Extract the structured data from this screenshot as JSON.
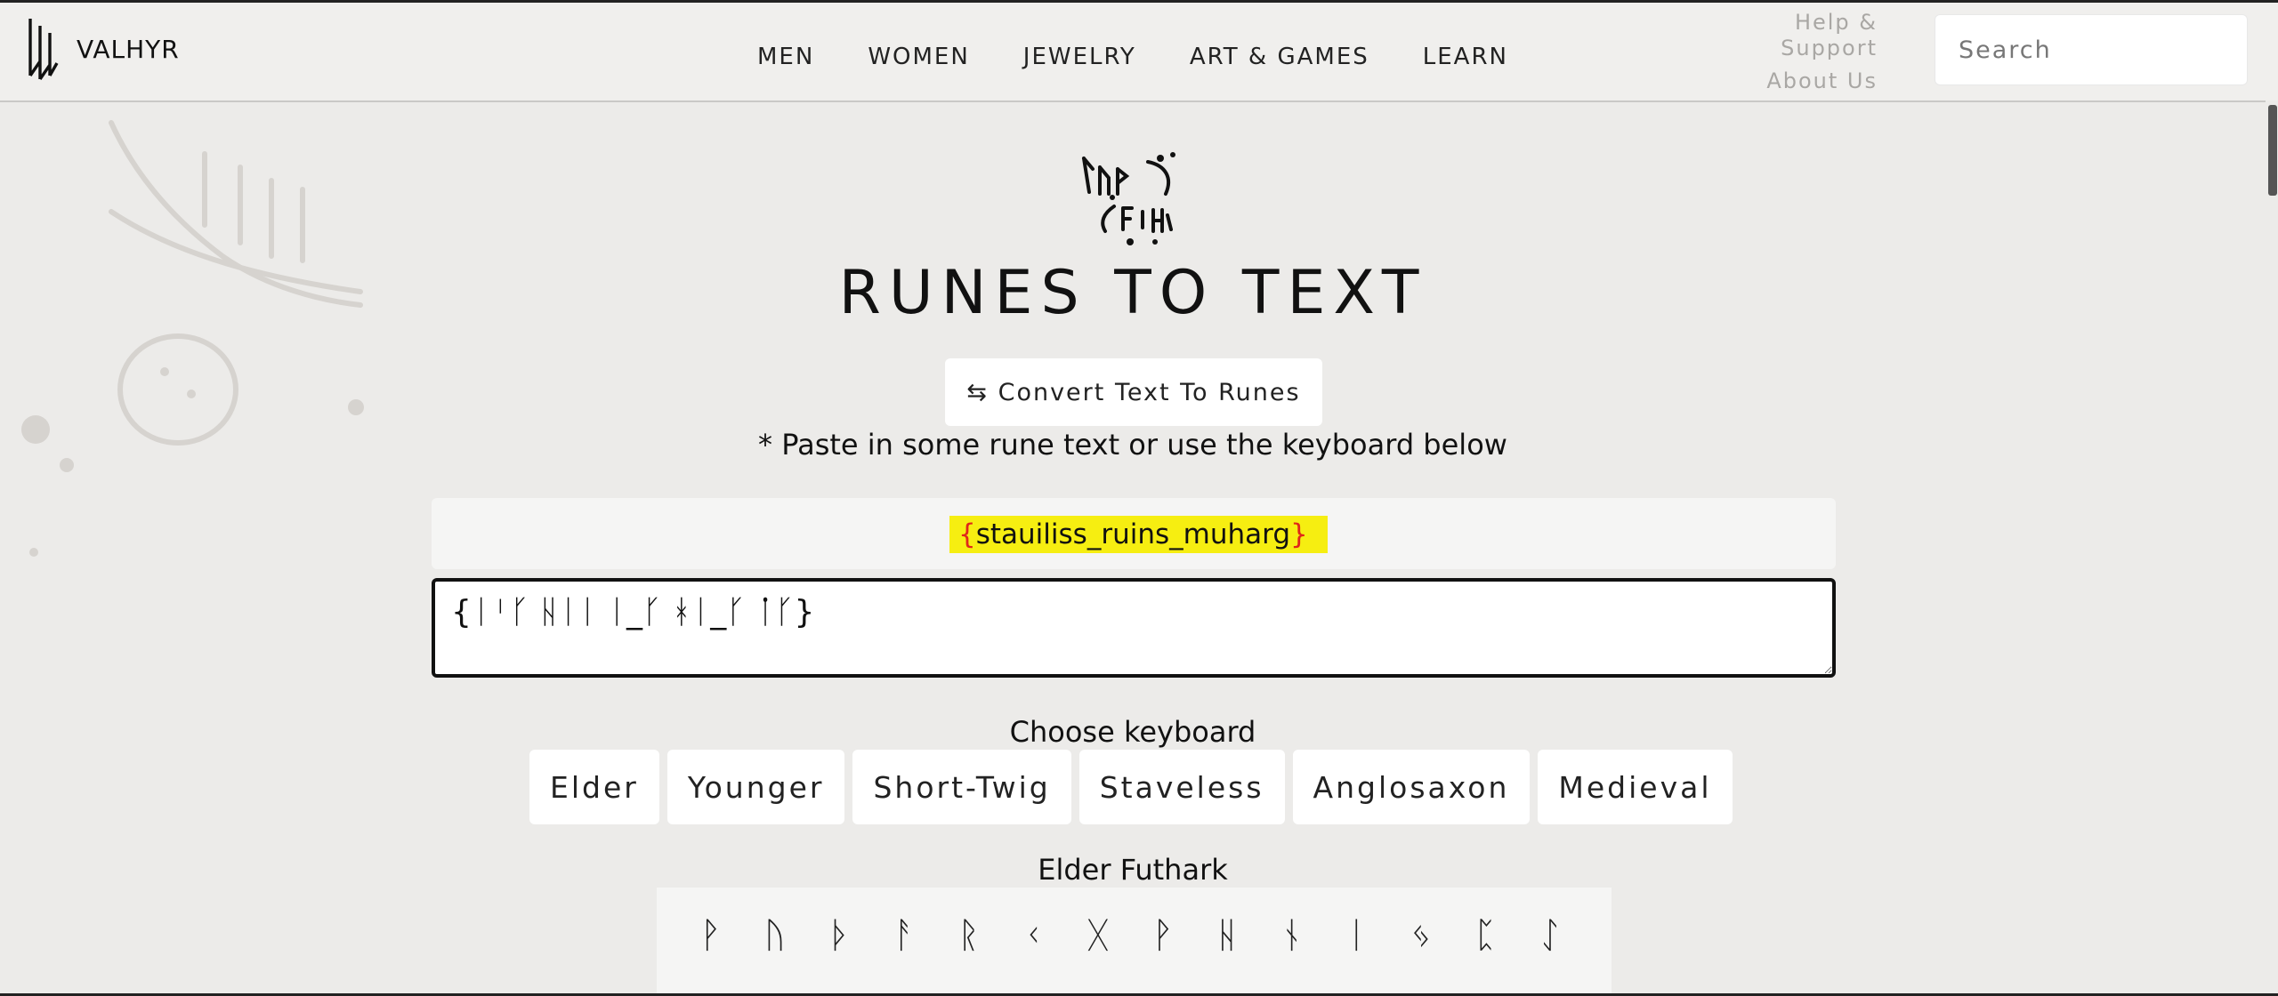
{
  "brand": {
    "name": "VALHYR",
    "logo_icon": "valhyr-rune-logo-icon"
  },
  "nav": {
    "items": [
      {
        "label": "MEN"
      },
      {
        "label": "WOMEN"
      },
      {
        "label": "JEWELRY"
      },
      {
        "label": "ART & GAMES"
      },
      {
        "label": "LEARN"
      }
    ]
  },
  "header": {
    "help_label": "Help & Support",
    "about_label": "About Us",
    "search_placeholder": "Search"
  },
  "main": {
    "title": "RUNES TO TEXT",
    "convert_button": "⇆ Convert Text To Runes",
    "hint": "* Paste in some rune text or use the keyboard below",
    "output": {
      "open_brace": "{",
      "text": "stauiliss_ruins_muharg",
      "close_brace": "}",
      "highlight_color": "#f6ee11"
    },
    "rune_input_value": "{ᛁᛌᚴ ᚺᛁᛁ ᛁ_ᚴ ᚼᛁ_ᚴ ᛙᚴ}",
    "keyboard_label": "Choose keyboard",
    "keyboards": [
      {
        "label": "Elder"
      },
      {
        "label": "Younger"
      },
      {
        "label": "Short-Twig"
      },
      {
        "label": "Staveless"
      },
      {
        "label": "Anglosaxon"
      },
      {
        "label": "Medieval"
      }
    ],
    "keyboard_title": "Elder Futhark",
    "runes": [
      "ᚹ",
      "ᚢ",
      "ᚦ",
      "ᚨ",
      "ᚱ",
      "ᚲ",
      "ᚷ",
      "ᚹ",
      "ᚺ",
      "ᚾ",
      "ᛁ",
      "ᛃ",
      "ᛈ",
      "ᛇ"
    ]
  },
  "colors": {
    "background": "#ecebe9",
    "brace_red": "#e0261a",
    "muted_text": "#a9a7a4"
  }
}
